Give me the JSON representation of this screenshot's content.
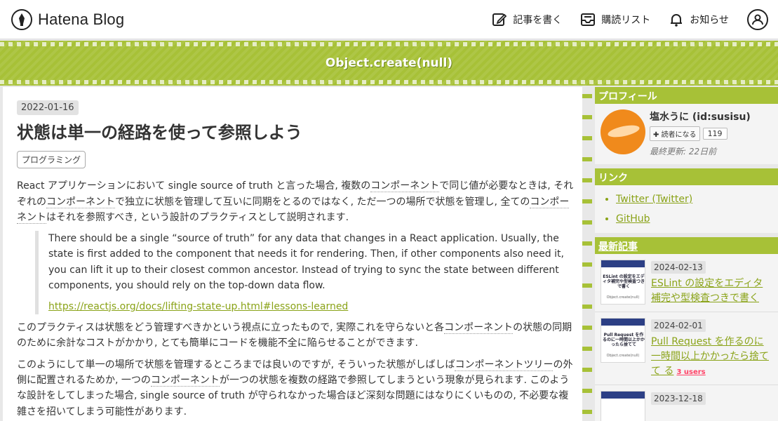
{
  "header": {
    "brand": "Hatena Blog",
    "nav": {
      "write": "記事を書く",
      "reading_list": "購読リスト",
      "notifications": "お知らせ"
    }
  },
  "blog": {
    "title": "Object.create(null)"
  },
  "entry": {
    "date": "2022-01-16",
    "title": "状態は単一の経路を使って参照しよう",
    "category": "プログラミング",
    "para1_a": "React アプリケーションにおいて single source of truth と言った場合, 複数の",
    "para1_kw1": "コンポーネント",
    "para1_b": "で同じ値が必要なときは, それぞれの",
    "para1_kw2": "コンポーネント",
    "para1_c": "で独立に状態を管理して互いに同期をとるのではなく, ただ一つの場所で状態を管理し, 全ての",
    "para1_kw3": "コンポーネント",
    "para1_d": "はそれを参照すべき, という設計のプラクティスとして説明されます.",
    "quote": "There should be a single “source of truth” for any data that changes in a React application. Usually, the state is first added to the component that needs it for rendering. Then, if other components also need it, you can lift it up to their closest common ancestor. Instead of trying to sync the state between different components, you should rely on the top-down data flow.",
    "quote_link": "https://reactjs.org/docs/lifting-state-up.html#lessons-learned",
    "para2_a": "このプラクティスは状態をどう管理すべきかという視点に立ったもので, 実際これを守らないと各",
    "para2_kw": "コンポーネント",
    "para2_b": "の状態の同期のために余計なコストがかかり, とても簡単にコードを機能不全に陥らせることができます.",
    "para3_a": "このようにして単一の場所で状態を管理するところまでは良いのですが, そういった状態がしばしば",
    "para3_kw1": "コンポーネントツリー",
    "para3_b": "の外側に配置されるためか, 一つの",
    "para3_kw2": "コンポーネント",
    "para3_c": "が一つの状態を複数の経路で参照してしまうという現象が見られます. このような設計をしてしまった場合, single source of truth が守られなかった場合ほど深刻な問題にはなりにくいものの, 不必要な複雑さを招いてしまう可能性があります."
  },
  "sidebar": {
    "profile_title": "プロフィール",
    "profile_name": "塩水うに (id:susisu)",
    "reader_button": "読者になる",
    "reader_count": "119",
    "last_update": "最終更新: 22日前",
    "links_title": "リンク",
    "links": [
      "Twitter (Twitter)",
      "GitHub"
    ],
    "recent_title": "最新記事",
    "recent": [
      {
        "date": "2024-02-13",
        "title": "ESLint の設定をエディタ補完や型検査つきで書く",
        "thumb_title": "ESLint の設定をエディタ補完や型検査つきで書く",
        "thumb_footer": "Object.create(null)",
        "bookmarks": ""
      },
      {
        "date": "2024-02-01",
        "title": "Pull Request を作るのに一時間以上かかったら捨てて る",
        "thumb_title": "Pull Request を作るのに一時間以上かかったら捨てて",
        "thumb_footer": "Object.create(null)",
        "bookmarks": "3 users"
      },
      {
        "date": "2023-12-18",
        "title": "",
        "thumb_title": "",
        "thumb_footer": "",
        "bookmarks": ""
      }
    ]
  },
  "colors": {
    "accent": "#a7c137",
    "link": "#8aa318",
    "bookmark": "#ff4166"
  }
}
